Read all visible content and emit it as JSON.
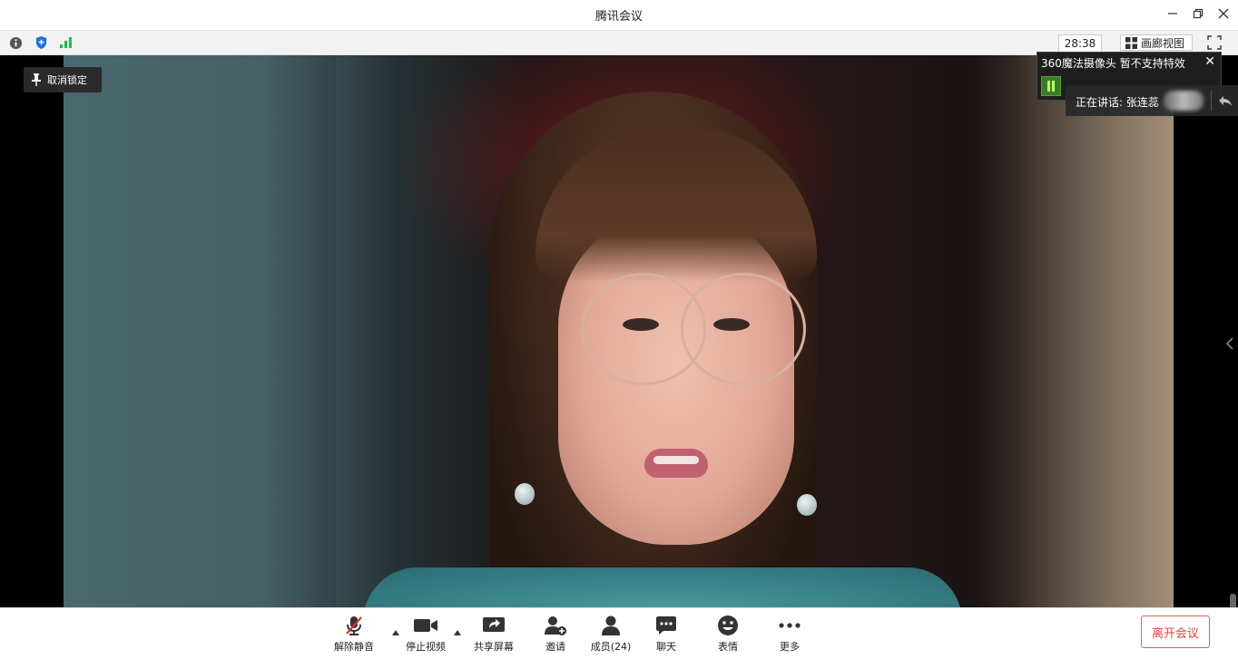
{
  "window": {
    "title": "腾讯会议"
  },
  "infobar": {
    "timer": "28:38",
    "gallery_label": "画廊视图"
  },
  "video": {
    "unlock_label": "取消锁定"
  },
  "camera_widget": {
    "title": "360魔法摄像头   暂不支持特效"
  },
  "speaking": {
    "label": "正在讲话: 张连蕊"
  },
  "toolbar": {
    "unmute": "解除静音",
    "stop_video": "停止视频",
    "share_screen": "共享屏幕",
    "invite": "邀请",
    "members": "成员(24)",
    "chat": "聊天",
    "emoji": "表情",
    "more": "更多",
    "leave": "离开会议"
  },
  "colors": {
    "accent_green": "#1fbf4a",
    "shield_blue": "#1e6fe0",
    "leave_red": "#d84040"
  }
}
